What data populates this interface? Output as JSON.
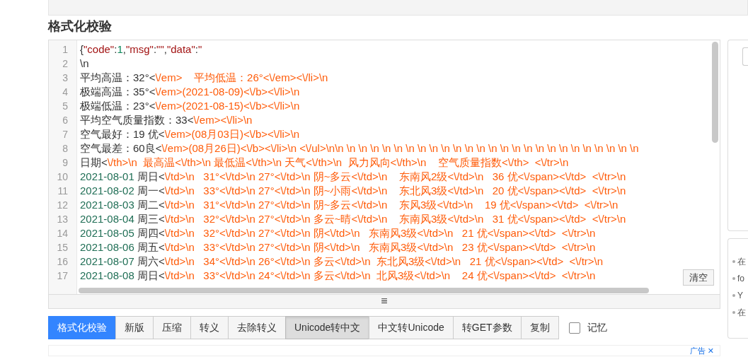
{
  "heading": "格式化校验",
  "editor": {
    "lines": [
      {
        "number": "1",
        "segments": [
          {
            "kind": "plain",
            "text": "{"
          },
          {
            "kind": "key",
            "text": "\"code\""
          },
          {
            "kind": "plain",
            "text": ":"
          },
          {
            "kind": "num",
            "text": "1"
          },
          {
            "kind": "plain",
            "text": ","
          },
          {
            "kind": "key",
            "text": "\"msg\""
          },
          {
            "kind": "plain",
            "text": ":"
          },
          {
            "kind": "key",
            "text": "\"\""
          },
          {
            "kind": "plain",
            "text": ","
          },
          {
            "kind": "key",
            "text": "\"data\""
          },
          {
            "kind": "plain",
            "text": ":"
          },
          {
            "kind": "key",
            "text": "\""
          }
        ]
      },
      {
        "number": "2",
        "segments": [
          {
            "kind": "plain",
            "text": "\\n"
          }
        ]
      },
      {
        "number": "3",
        "segments": [
          {
            "kind": "plain",
            "text": "平均高温：32°<"
          },
          {
            "kind": "str",
            "text": "\\/em>    平均低温：26°<\\/em><\\/li>\\n"
          }
        ]
      },
      {
        "number": "4",
        "segments": [
          {
            "kind": "plain",
            "text": "极端高温：35°<"
          },
          {
            "kind": "str",
            "text": "\\/em>(2021-08-09)<\\/b><\\/li>\\n"
          }
        ]
      },
      {
        "number": "5",
        "segments": [
          {
            "kind": "plain",
            "text": "极端低温：23°<"
          },
          {
            "kind": "str",
            "text": "\\/em>(2021-08-15)<\\/b><\\/li>\\n"
          }
        ]
      },
      {
        "number": "6",
        "segments": [
          {
            "kind": "plain",
            "text": "平均空气质量指数：33<"
          },
          {
            "kind": "str",
            "text": "\\/em><\\/li>\\n"
          }
        ]
      },
      {
        "number": "7",
        "segments": [
          {
            "kind": "plain",
            "text": "空气最好：19 优<"
          },
          {
            "kind": "str",
            "text": "\\/em>(08月03日)<\\/b><\\/li>\\n"
          }
        ]
      },
      {
        "number": "8",
        "segments": [
          {
            "kind": "plain",
            "text": "空气最差：60良<"
          },
          {
            "kind": "str",
            "text": "\\/em>(08月26日)<\\/b><\\/li>\\n <\\/ul>\\n\\n \\n \\n \\n \\n \\n \\n \\n \\n \\n \\n \\n \\n \\n \\n \\n \\n \\n \\n \\n \\n \\n \\n \\n \\n \\n"
          }
        ]
      },
      {
        "number": "9",
        "segments": [
          {
            "kind": "plain",
            "text": "日期<"
          },
          {
            "kind": "str",
            "text": "\\/th>\\n  最高温<\\/th>\\n 最低温<\\/th>\\n 天气<\\/th>\\n  风力风向<\\/th>\\n    空气质量指数<\\/th>  <\\/tr>\\n"
          }
        ]
      },
      {
        "number": "10",
        "segments": [
          {
            "kind": "date",
            "text": "2021-08-01"
          },
          {
            "kind": "plain",
            "text": " 周日<"
          },
          {
            "kind": "str",
            "text": "\\/td>\\n   31°<\\/td>\\n 27°<\\/td>\\n 阴~多云<\\/td>\\n    东南风2级<\\/td>\\n   36 优<\\/span><\\/td>  <\\/tr>\\n"
          }
        ]
      },
      {
        "number": "11",
        "segments": [
          {
            "kind": "date",
            "text": "2021-08-02"
          },
          {
            "kind": "plain",
            "text": " 周一<"
          },
          {
            "kind": "str",
            "text": "\\/td>\\n   33°<\\/td>\\n 27°<\\/td>\\n 阴~小雨<\\/td>\\n    东北风3级<\\/td>\\n   20 优<\\/span><\\/td>  <\\/tr>\\n"
          }
        ]
      },
      {
        "number": "12",
        "segments": [
          {
            "kind": "date",
            "text": "2021-08-03"
          },
          {
            "kind": "plain",
            "text": " 周二<"
          },
          {
            "kind": "str",
            "text": "\\/td>\\n   31°<\\/td>\\n 27°<\\/td>\\n 阴~多云<\\/td>\\n    东风3级<\\/td>\\n    19 优<\\/span><\\/td>  <\\/tr>\\n"
          }
        ]
      },
      {
        "number": "13",
        "segments": [
          {
            "kind": "date",
            "text": "2021-08-04"
          },
          {
            "kind": "plain",
            "text": " 周三<"
          },
          {
            "kind": "str",
            "text": "\\/td>\\n   32°<\\/td>\\n 27°<\\/td>\\n 多云~晴<\\/td>\\n    东南风3级<\\/td>\\n   31 优<\\/span><\\/td>  <\\/tr>\\n"
          }
        ]
      },
      {
        "number": "14",
        "segments": [
          {
            "kind": "date",
            "text": "2021-08-05"
          },
          {
            "kind": "plain",
            "text": " 周四<"
          },
          {
            "kind": "str",
            "text": "\\/td>\\n   32°<\\/td>\\n 27°<\\/td>\\n 阴<\\/td>\\n   东南风3级<\\/td>\\n   21 优<\\/span><\\/td>  <\\/tr>\\n"
          }
        ]
      },
      {
        "number": "15",
        "segments": [
          {
            "kind": "date",
            "text": "2021-08-06"
          },
          {
            "kind": "plain",
            "text": " 周五<"
          },
          {
            "kind": "str",
            "text": "\\/td>\\n   33°<\\/td>\\n 27°<\\/td>\\n 阴<\\/td>\\n   东南风3级<\\/td>\\n   23 优<\\/span><\\/td>  <\\/tr>\\n"
          }
        ]
      },
      {
        "number": "16",
        "segments": [
          {
            "kind": "date",
            "text": "2021-08-07"
          },
          {
            "kind": "plain",
            "text": " 周六<"
          },
          {
            "kind": "str",
            "text": "\\/td>\\n   34°<\\/td>\\n 26°<\\/td>\\n 多云<\\/td>\\n  东北风3级<\\/td>\\n   21 优<\\/span><\\/td>  <\\/tr>\\n"
          }
        ]
      },
      {
        "number": "17",
        "segments": [
          {
            "kind": "date",
            "text": "2021-08-08"
          },
          {
            "kind": "plain",
            "text": " 周日<"
          },
          {
            "kind": "str",
            "text": "\\/td>\\n   33°<\\/td>\\n 24°<\\/td>\\n 多云<\\/td>\\n  北风3级<\\/td>\\n    24 优<\\/span><\\/td>  <\\/tr>\\n"
          }
        ]
      }
    ],
    "clear_button": "清空",
    "resize_handle": "≡"
  },
  "toolbar": {
    "buttons": [
      {
        "label": "格式化校验",
        "kind": "primary",
        "pressed": false
      },
      {
        "label": "新版",
        "kind": "default",
        "pressed": false
      },
      {
        "label": "压缩",
        "kind": "default",
        "pressed": false
      },
      {
        "label": "转义",
        "kind": "default",
        "pressed": false
      },
      {
        "label": "去除转义",
        "kind": "default",
        "pressed": false
      },
      {
        "label": "Unicode转中文",
        "kind": "default",
        "pressed": true
      },
      {
        "label": "中文转Unicode",
        "kind": "default",
        "pressed": false
      },
      {
        "label": "转GET参数",
        "kind": "default",
        "pressed": false
      },
      {
        "label": "复制",
        "kind": "default",
        "pressed": false
      }
    ],
    "remember": {
      "label": "记忆",
      "checked": false
    }
  },
  "side_panel": {
    "items": [
      "在",
      "fo",
      "Y",
      "在"
    ]
  },
  "ad": {
    "label": "广告",
    "close": "✕"
  }
}
